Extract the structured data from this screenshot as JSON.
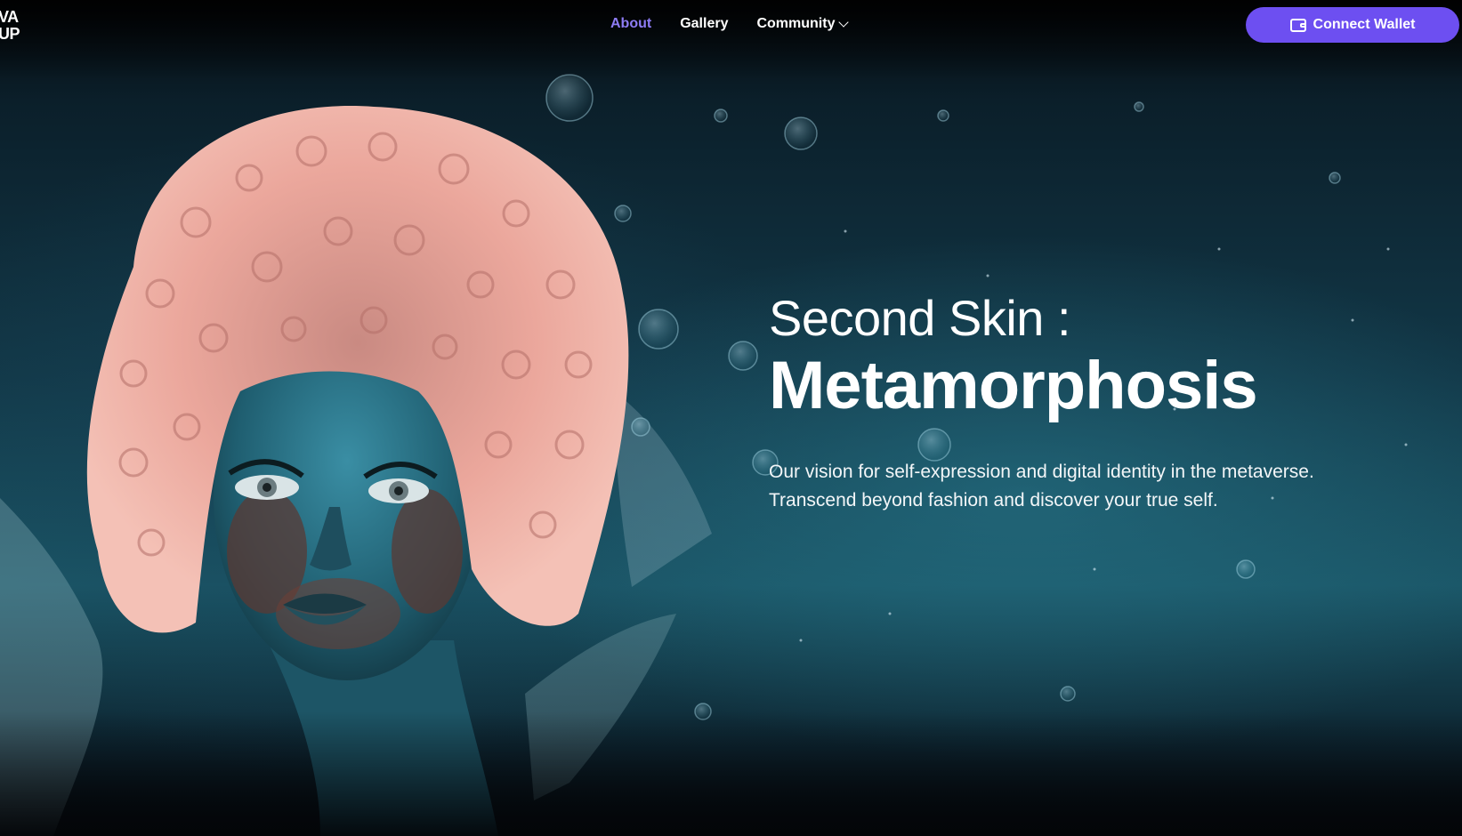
{
  "logo": {
    "line1": "VA",
    "line2": "UP"
  },
  "nav": {
    "items": [
      {
        "label": "About",
        "active": true
      },
      {
        "label": "Gallery",
        "active": false
      },
      {
        "label": "Community",
        "active": false,
        "has_dropdown": true
      }
    ]
  },
  "header": {
    "connect_label": "Connect Wallet",
    "connect_icon": "wallet-icon"
  },
  "hero": {
    "subtitle": "Second Skin :",
    "title": "Metamorphosis",
    "description": "Our vision for self-expression and digital identity in the metaverse. Transcend beyond fashion and discover your true self.",
    "image": "avatar-with-pink-curly-hair-and-water-splash"
  },
  "colors": {
    "accent": "#6d4ff1",
    "active_nav": "#8e7cf4",
    "hair": "#e8a59a",
    "skin": "#2a6f83"
  }
}
